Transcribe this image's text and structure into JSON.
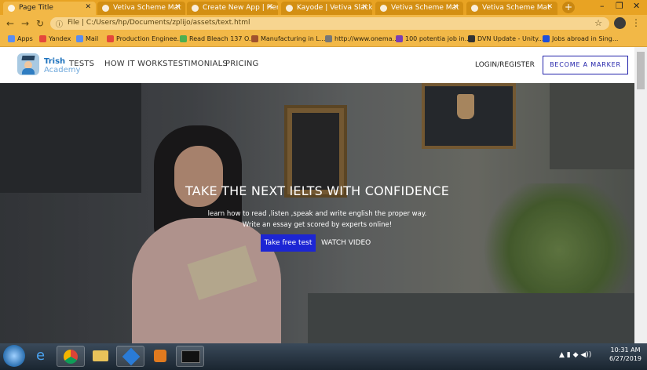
{
  "browser": {
    "tabs": [
      {
        "label": "Page Title",
        "active": true
      },
      {
        "label": "Vetiva Scheme Mat",
        "active": false
      },
      {
        "label": "Create New App | Hero",
        "active": false
      },
      {
        "label": "Kayode | Vetiva Slack",
        "active": false
      },
      {
        "label": "Vetiva Scheme Mat",
        "active": false
      },
      {
        "label": "Vetiva Scheme Mat",
        "active": false
      }
    ],
    "new_tab_label": "+",
    "address": "File  |  C:/Users/hp/Documents/zplijo/assets/text.html",
    "bookmarks": [
      {
        "label": "Apps",
        "color": "#5b8def"
      },
      {
        "label": "Yandex",
        "color": "#e5483b"
      },
      {
        "label": "Mail",
        "color": "#5b8def"
      },
      {
        "label": "Production Enginee...",
        "color": "#e5483b"
      },
      {
        "label": "Read Bleach 137 O...",
        "color": "#4caf50"
      },
      {
        "label": "Manufacturing in L...",
        "color": "#a0522d"
      },
      {
        "label": "http://www.onema...",
        "color": "#777"
      },
      {
        "label": "100 potentia job in...",
        "color": "#7b3fb3"
      },
      {
        "label": "DVN Update - Unity...",
        "color": "#333"
      },
      {
        "label": "Jobs abroad in Sing...",
        "color": "#1e4fd9"
      }
    ]
  },
  "site": {
    "brand_line1": "Trish",
    "brand_line2": "Academy",
    "nav": [
      "TESTS",
      "HOW IT WORKS",
      "TESTIMONIALS",
      "PRICING"
    ],
    "login_label": "LOGIN/REGISTER",
    "marker_label": "BECOME A MARKER"
  },
  "hero": {
    "title": "TAKE THE NEXT IELTS WITH CONFIDENCE",
    "line1": "learn how to read ,listen ,speak and write english the proper way.",
    "line2": "Write an essay get scored by experts online!",
    "cta_label": "Take free test",
    "watch_label": "WATCH VIDEO"
  },
  "taskbar": {
    "clock_time": "10:31 AM",
    "clock_date": "6/27/2019"
  },
  "colors": {
    "tab_bar": "#e8a323",
    "cta": "#1c25d4",
    "marker_border": "#2222aa"
  }
}
